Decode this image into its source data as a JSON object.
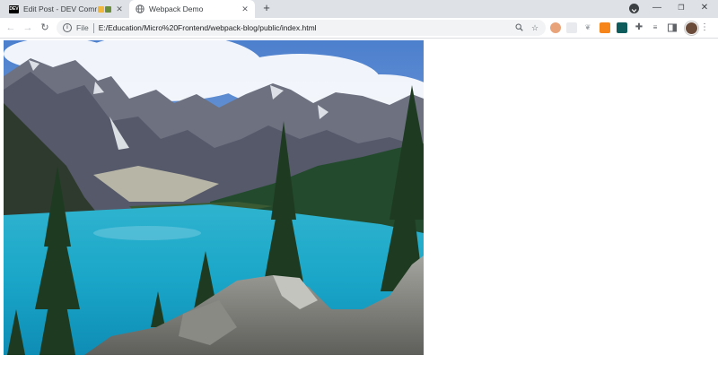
{
  "browser": {
    "tabs": [
      {
        "title": "Edit Post - DEV Community",
        "favicon": "dev-logo-icon",
        "active": false
      },
      {
        "title": "Webpack Demo",
        "favicon": "globe-icon",
        "active": true
      }
    ],
    "new_tab_icon": "+",
    "window_controls": {
      "minimize": "—",
      "restore": "❐",
      "close": "✕"
    }
  },
  "toolbar": {
    "file_label": "File",
    "url": "E:/Education/Micro%20Frontend/webpack-blog/public/index.html"
  },
  "page": {
    "image": {
      "name": "moraine-lake-photo",
      "subject": "turquoise mountain lake with pine trees and rocky foreground"
    }
  },
  "colors": {
    "tabstrip": "#dee1e6",
    "toolbar": "#ffffff",
    "omnibox": "#f1f3f4",
    "lake": "#1aa6c8"
  }
}
